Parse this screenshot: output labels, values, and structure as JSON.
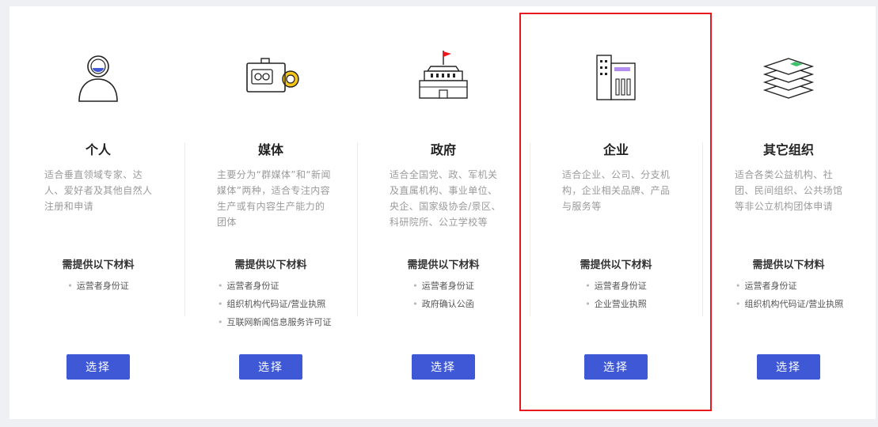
{
  "cards": [
    {
      "icon": "person-icon",
      "title": "个人",
      "desc": "适合垂直领域专家、达人、爱好者及其他自然人注册和申请",
      "materials_title": "需提供以下材料",
      "materials": [
        "运营者身份证"
      ],
      "button_label": "选择"
    },
    {
      "icon": "video-camera-icon",
      "title": "媒体",
      "desc": "主要分为“群媒体”和“新闻媒体”两种，适合专注内容生产或有内容生产能力的团体",
      "materials_title": "需提供以下材料",
      "materials": [
        "运营者身份证",
        "组织机构代码证/营业执照",
        "互联网新闻信息服务许可证"
      ],
      "button_label": "选择"
    },
    {
      "icon": "government-building-icon",
      "title": "政府",
      "desc": "适合全国党、政、军机关及直属机构、事业单位、央企、国家级协会/景区、科研院所、公立学校等",
      "materials_title": "需提供以下材料",
      "materials": [
        "运营者身份证",
        "政府确认公函"
      ],
      "button_label": "选择"
    },
    {
      "icon": "enterprise-building-icon",
      "title": "企业",
      "desc": "适合企业、公司、分支机构，企业相关品牌、产品与服务等",
      "materials_title": "需提供以下材料",
      "materials": [
        "运营者身份证",
        "企业营业执照"
      ],
      "button_label": "选择"
    },
    {
      "icon": "layers-icon",
      "title": "其它组织",
      "desc": "适合各类公益机构、社团、民间组织、公共场馆等非公立机构团体申请",
      "materials_title": "需提供以下材料",
      "materials": [
        "运营者身份证",
        "组织机构代码证/营业执照"
      ],
      "button_label": "选择"
    }
  ],
  "colors": {
    "accent": "#3f59d6",
    "highlight": "#e8191e",
    "title": "#222222",
    "desc": "#9a9a9a"
  }
}
